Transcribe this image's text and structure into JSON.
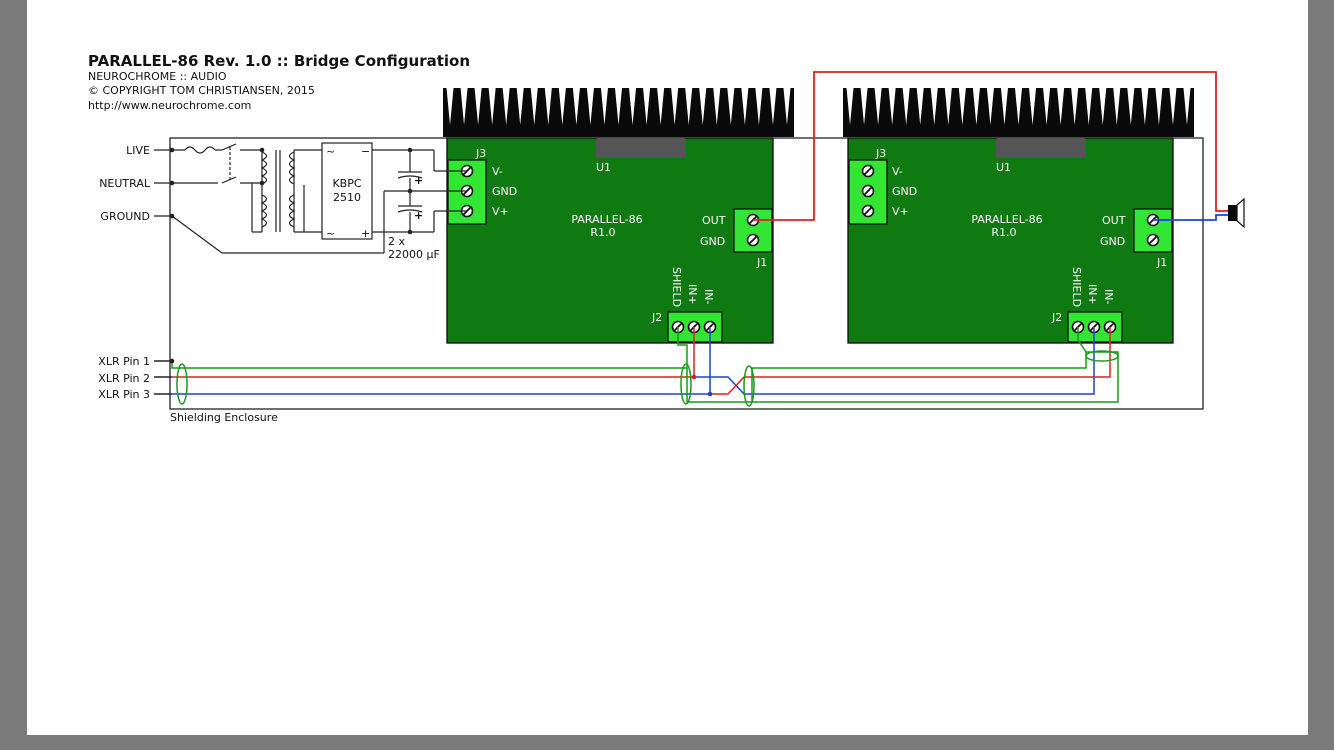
{
  "header": {
    "title": "PARALLEL-86 Rev. 1.0 :: Bridge Configuration",
    "brand": "NEUROCHROME :: AUDIO",
    "copyright": "© COPYRIGHT TOM CHRISTIANSEN, 2015",
    "url": "http://www.neurochrome.com"
  },
  "mains": {
    "live": "LIVE",
    "neutral": "NEUTRAL",
    "ground": "GROUND"
  },
  "psu": {
    "bridge_name": "KBPC",
    "bridge_part": "2510",
    "ac1": "~",
    "ac2": "~",
    "minus": "−",
    "plus": "+",
    "cap_plus_1": "+",
    "cap_plus_2": "+",
    "cap_qty": "2 x",
    "cap_value": "22000 µF"
  },
  "xlr": {
    "pin1": "XLR Pin 1",
    "pin2": "XLR Pin 2",
    "pin3": "XLR Pin 3"
  },
  "enclosure_label": "Shielding Enclosure",
  "boards": [
    {
      "u1": "U1",
      "name": "PARALLEL-86",
      "rev": "R1.0",
      "j3": "J3",
      "vminus": "V-",
      "gnd": "GND",
      "vplus": "V+",
      "out": "OUT",
      "out_gnd": "GND",
      "j1": "J1",
      "j2": "J2",
      "shield": "SHIELD",
      "in_plus": "IN+",
      "in_minus": "IN-"
    },
    {
      "u1": "U1",
      "name": "PARALLEL-86",
      "rev": "R1.0",
      "j3": "J3",
      "vminus": "V-",
      "gnd": "GND",
      "vplus": "V+",
      "out": "OUT",
      "out_gnd": "GND",
      "j1": "J1",
      "j2": "J2",
      "shield": "SHIELD",
      "in_plus": "IN+",
      "in_minus": "IN-"
    }
  ],
  "colors": {
    "pcb": "#0f7a12",
    "terminal": "#33e633",
    "wire_red": "#e02020",
    "wire_blue": "#1f3fe0",
    "wire_green": "#1a9a1a",
    "heatsink": "#0a0a0a"
  }
}
